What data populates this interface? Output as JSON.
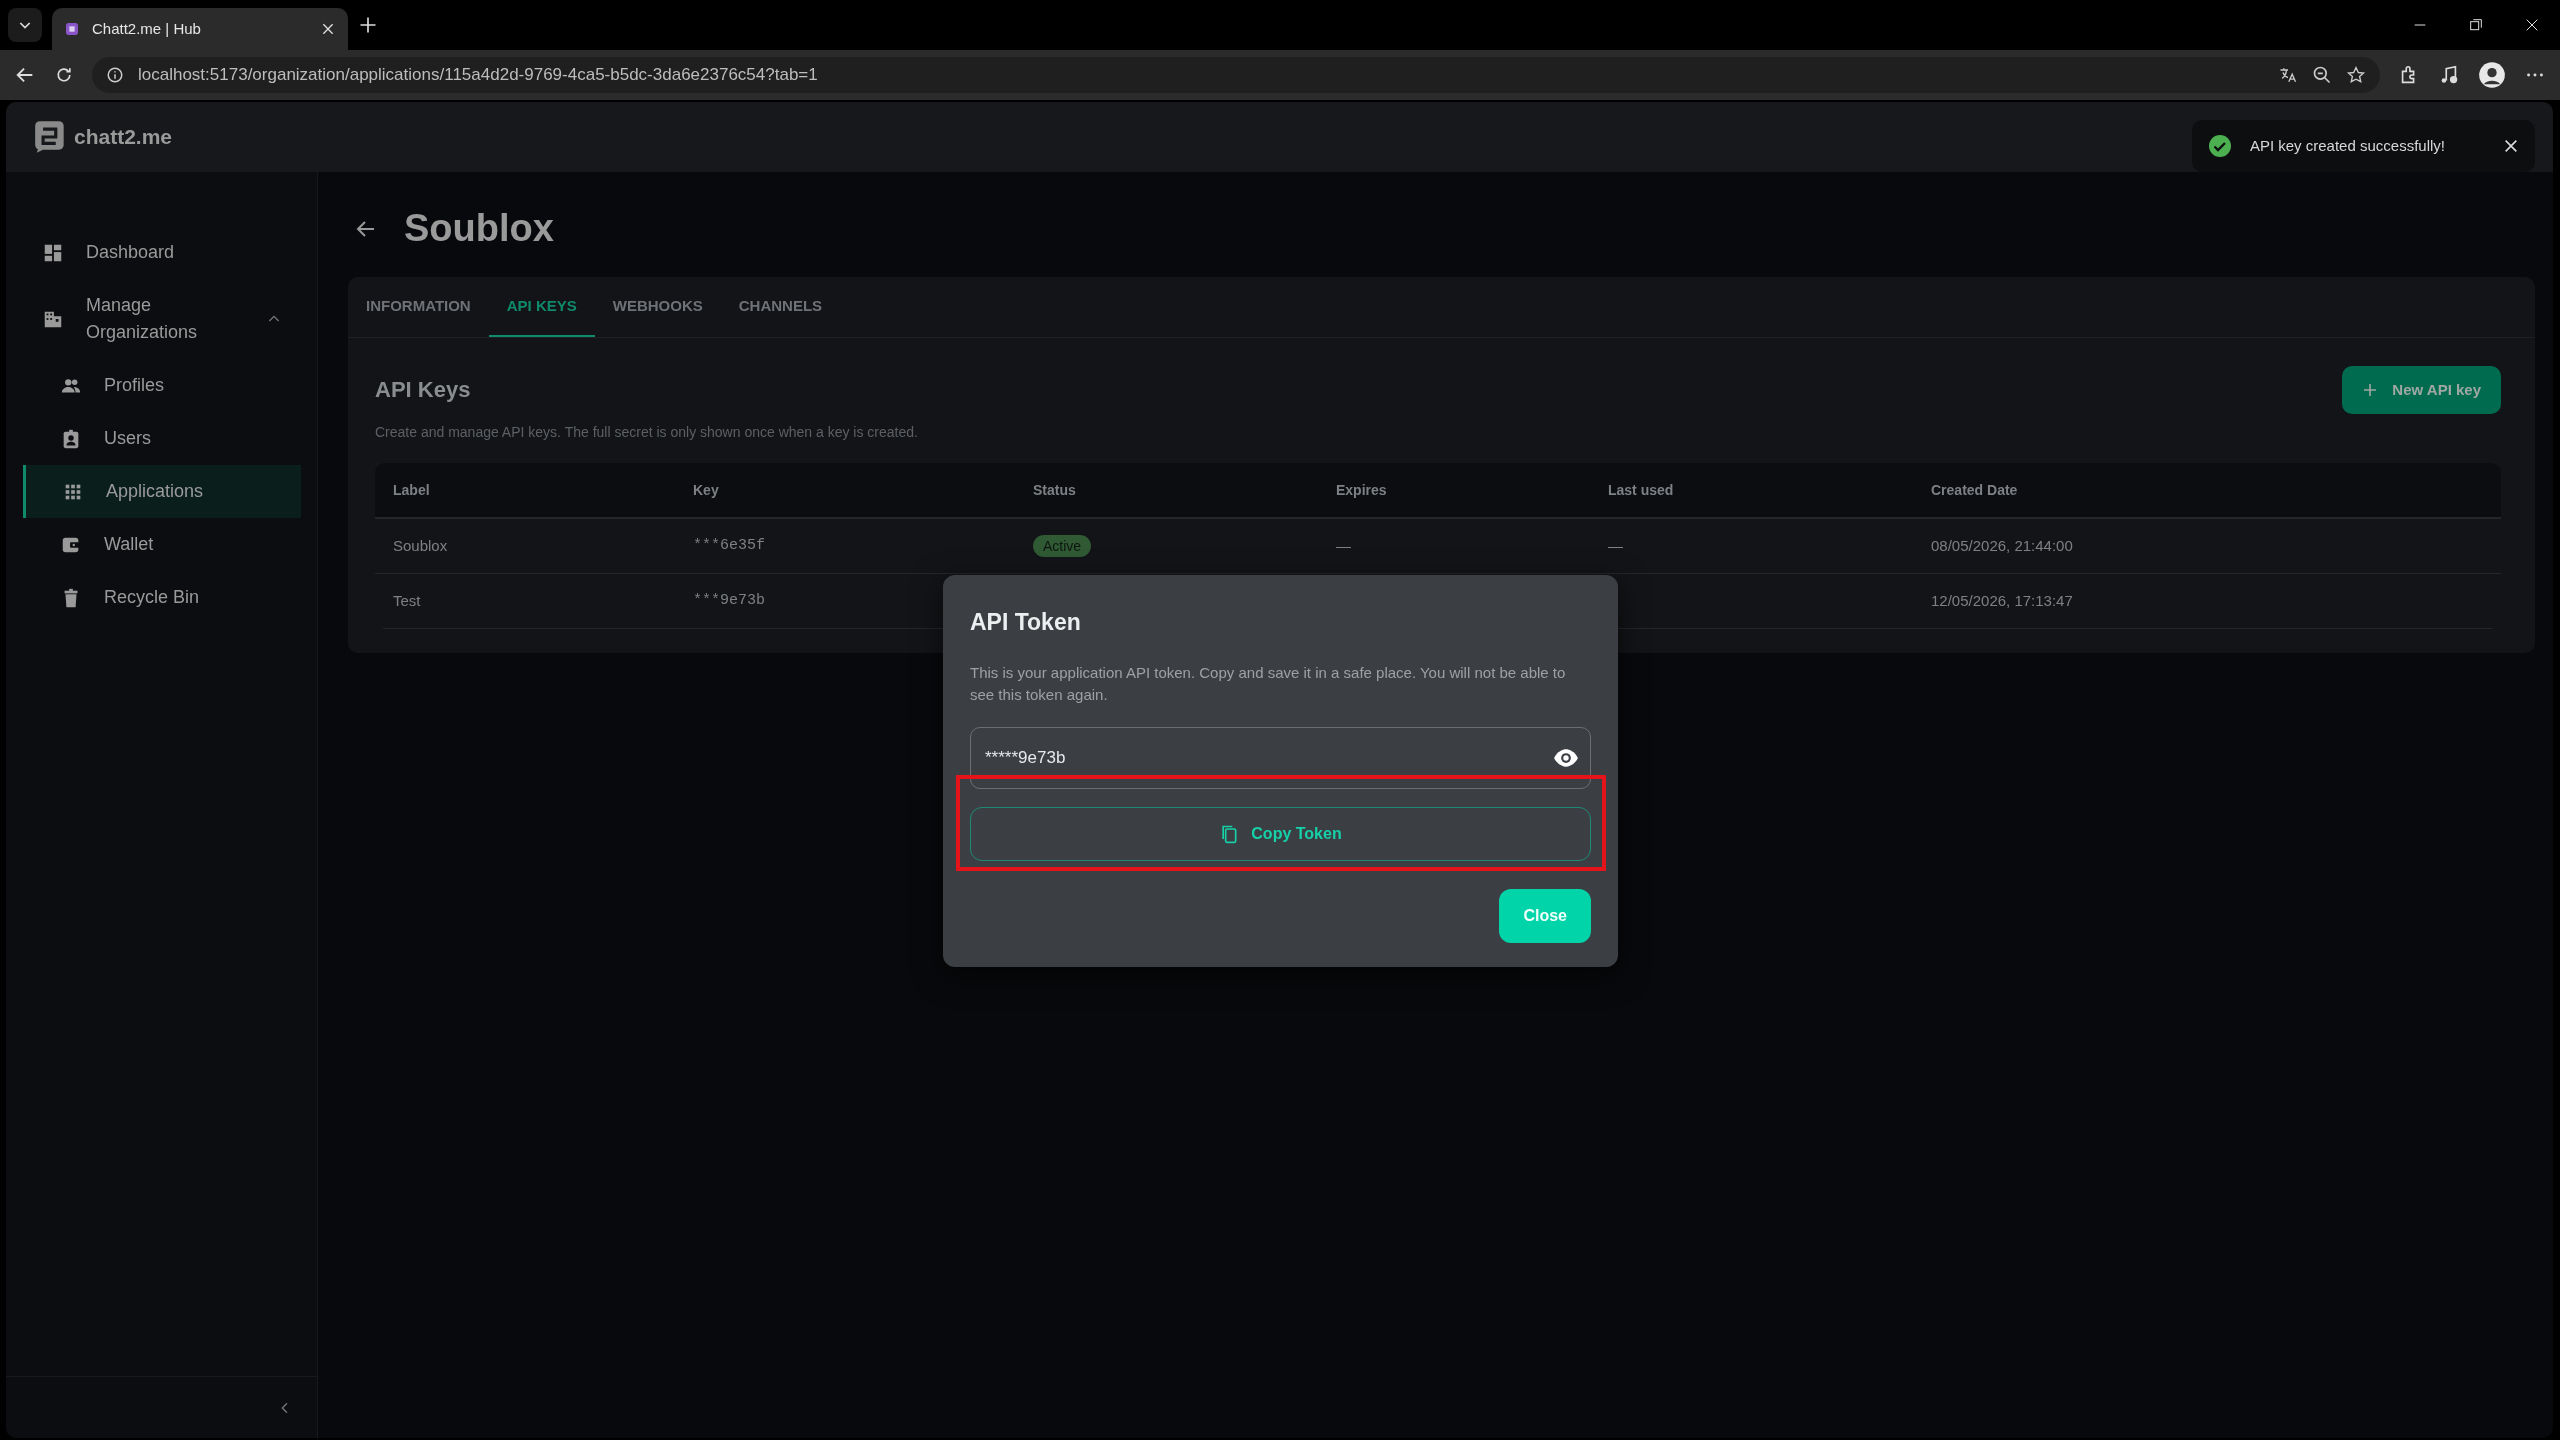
{
  "browser": {
    "tab_title": "Chatt2.me | Hub",
    "url": "localhost:5173/organization/applications/115a4d2d-9769-4ca5-b5dc-3da6e2376c54?tab=1"
  },
  "app": {
    "logo": "chatt2.me"
  },
  "toast": {
    "message": "API key created successfully!"
  },
  "sidebar": {
    "items": [
      {
        "label": "Dashboard",
        "selected": false
      },
      {
        "label": "Manage Organizations",
        "selected": false,
        "expanded": true,
        "children": [
          {
            "label": "Profiles",
            "selected": false
          },
          {
            "label": "Users",
            "selected": false
          },
          {
            "label": "Applications",
            "selected": true
          },
          {
            "label": "Wallet",
            "selected": false
          },
          {
            "label": "Recycle Bin",
            "selected": false
          }
        ]
      }
    ]
  },
  "page": {
    "title": "Soublox"
  },
  "tabs": [
    {
      "label": "INFORMATION",
      "selected": false
    },
    {
      "label": "API KEYS",
      "selected": true
    },
    {
      "label": "WEBHOOKS",
      "selected": false
    },
    {
      "label": "CHANNELS",
      "selected": false
    }
  ],
  "section": {
    "title": "API Keys",
    "description": "Create and manage API keys. The full secret is only shown once when a key is created.",
    "new_button": "New API key"
  },
  "table": {
    "columns": [
      "Label",
      "Key",
      "Status",
      "Expires",
      "Last used",
      "Created Date"
    ],
    "rows": [
      {
        "label": "Soublox",
        "key": "***6e35f",
        "status": "Active",
        "expires": "—",
        "last_used": "—",
        "created": "08/05/2026, 21:44:00"
      },
      {
        "label": "Test",
        "key": "***9e73b",
        "created": "12/05/2026, 17:13:47"
      }
    ]
  },
  "dialog": {
    "title": "API Token",
    "text": "This is your application API token. Copy and save it in a safe place. You will not be able to see this token again.",
    "token": "*****9e73b",
    "copy_button": "Copy Token",
    "close_button": "Close",
    "highlighted": true
  }
}
